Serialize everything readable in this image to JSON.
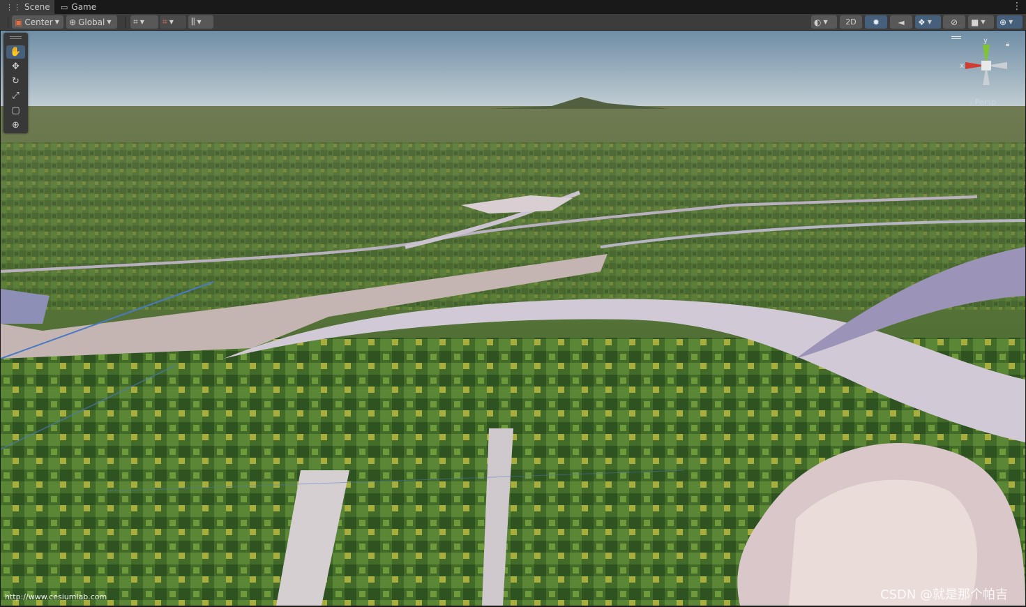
{
  "tabs": [
    {
      "label": "Scene",
      "icon": "grid-icon"
    },
    {
      "label": "Game",
      "icon": "gamepad-icon"
    }
  ],
  "toolbar": {
    "pivot_label": "Center",
    "space_label": "Global",
    "mode_2d_label": "2D"
  },
  "tools": [
    "hand",
    "move",
    "rotate",
    "scale",
    "rect",
    "transform"
  ],
  "gizmo": {
    "y_label": "y",
    "x_label": "x",
    "persp_label": "‹ Persp"
  },
  "overlay": {
    "url": "http://www.cesiumlab.com",
    "watermark": "CSDN @就是那个帕吉"
  },
  "colors": {
    "accent": "#46607c",
    "axis_x": "#d23b32",
    "axis_y": "#7fc431",
    "sky_top": "#6f8ea6",
    "sky_bottom": "#c9d3d7"
  }
}
